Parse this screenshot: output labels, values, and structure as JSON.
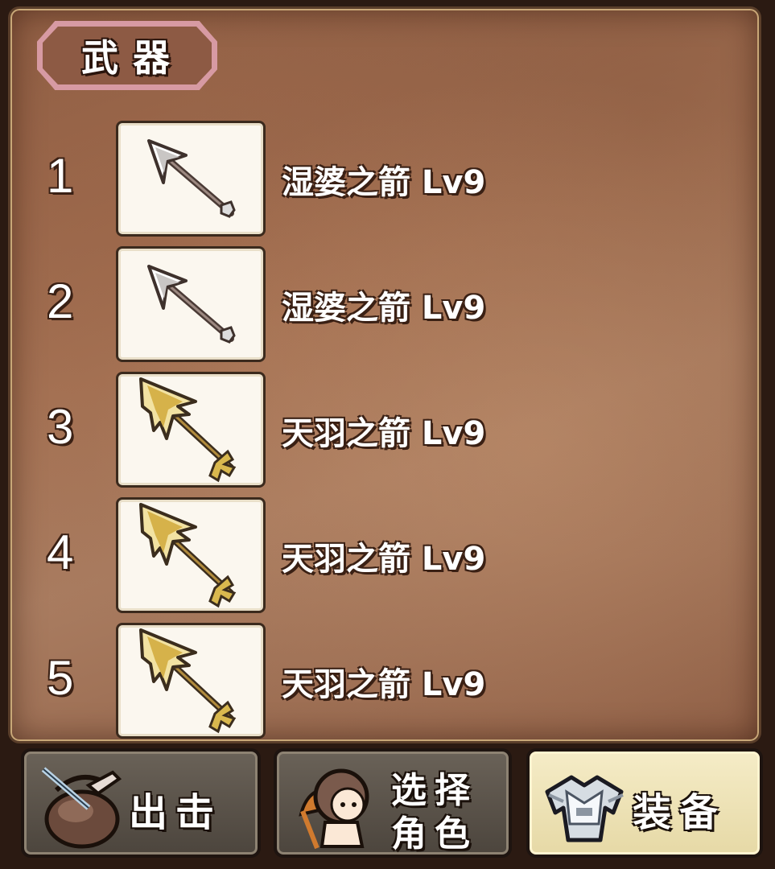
{
  "panel": {
    "title": "武器"
  },
  "weapons": [
    {
      "index": "1",
      "name": "湿婆之箭 Lv9",
      "icon": "silver-arrow-icon"
    },
    {
      "index": "2",
      "name": "湿婆之箭 Lv9",
      "icon": "silver-arrow-icon"
    },
    {
      "index": "3",
      "name": "天羽之箭 Lv9",
      "icon": "golden-feather-arrow-icon"
    },
    {
      "index": "4",
      "name": "天羽之箭 Lv9",
      "icon": "golden-feather-arrow-icon"
    },
    {
      "index": "5",
      "name": "天羽之箭 Lv9",
      "icon": "golden-feather-arrow-icon"
    }
  ],
  "nav": {
    "sortie": {
      "label": "出击",
      "icon": "sack-icon"
    },
    "select": {
      "line1": "选择",
      "line2": "角色",
      "icon": "character-icon"
    },
    "equip": {
      "label": "装备",
      "icon": "armor-icon",
      "active": true
    }
  },
  "colors": {
    "panel": "#a0705a",
    "slot": "#fbf7ef",
    "tab_border": "#d79aa3",
    "active_button": "#efe3b8"
  }
}
